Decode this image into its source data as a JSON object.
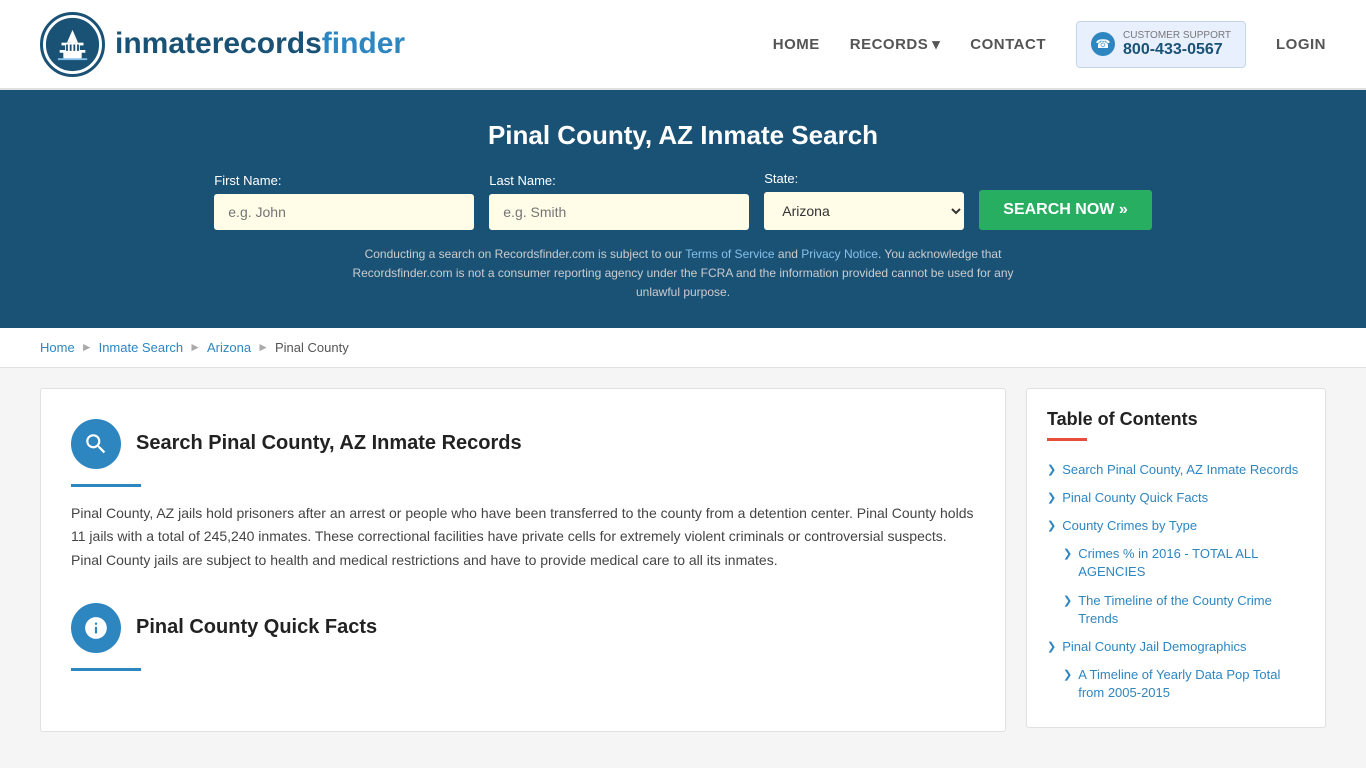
{
  "header": {
    "logo_text_part1": "inmaterecords",
    "logo_text_part2": "finder",
    "nav": {
      "home": "HOME",
      "records": "RECORDS",
      "contact": "CONTACT",
      "support_label": "CUSTOMER SUPPORT",
      "support_number": "800-433-0567",
      "login": "LOGIN"
    }
  },
  "hero": {
    "title": "Pinal County, AZ Inmate Search",
    "first_name_label": "First Name:",
    "first_name_placeholder": "e.g. John",
    "last_name_label": "Last Name:",
    "last_name_placeholder": "e.g. Smith",
    "state_label": "State:",
    "state_value": "Arizona",
    "search_button": "SEARCH NOW »",
    "disclaimer": "Conducting a search on Recordsfinder.com is subject to our Terms of Service and Privacy Notice. You acknowledge that Recordsfinder.com is not a consumer reporting agency under the FCRA and the information provided cannot be used for any unlawful purpose."
  },
  "breadcrumb": {
    "home": "Home",
    "inmate_search": "Inmate Search",
    "arizona": "Arizona",
    "pinal_county": "Pinal County"
  },
  "sections": [
    {
      "id": "search-section",
      "icon_type": "search",
      "title": "Search Pinal County, AZ Inmate Records",
      "text": "Pinal County, AZ jails hold prisoners after an arrest or people who have been transferred to the county from a detention center. Pinal County holds 11 jails with a total of 245,240 inmates. These correctional facilities have private cells for extremely violent criminals or controversial suspects. Pinal County jails are subject to health and medical restrictions and have to provide medical care to all its inmates."
    },
    {
      "id": "quick-facts-section",
      "icon_type": "info",
      "title": "Pinal County Quick Facts",
      "text": ""
    }
  ],
  "toc": {
    "title": "Table of Contents",
    "items": [
      {
        "label": "Search Pinal County, AZ Inmate Records",
        "indent": false
      },
      {
        "label": "Pinal County Quick Facts",
        "indent": false
      },
      {
        "label": "County Crimes by Type",
        "indent": false
      },
      {
        "label": "Crimes % in 2016 - TOTAL ALL AGENCIES",
        "indent": true
      },
      {
        "label": "The Timeline of the County Crime Trends",
        "indent": true
      },
      {
        "label": "Pinal County Jail Demographics",
        "indent": false
      },
      {
        "label": "A Timeline of Yearly Data Pop Total from 2005-2015",
        "indent": true
      }
    ]
  }
}
